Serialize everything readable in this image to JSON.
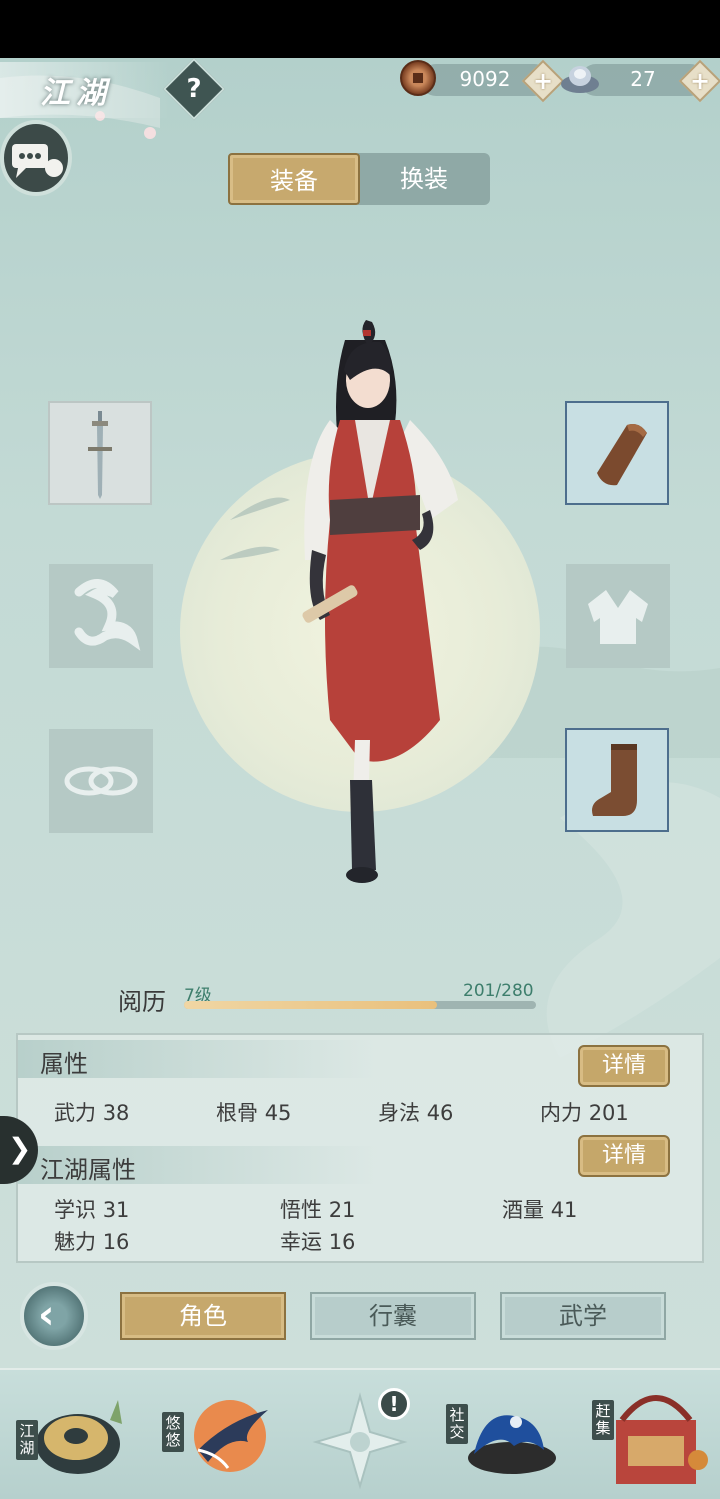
{
  "header": {
    "title": "江湖",
    "help_label": "?",
    "copper_value": "9092",
    "silver_value": "27",
    "plus_label": "+"
  },
  "tabs": {
    "equip": "装备",
    "outfit": "换装"
  },
  "slots": {
    "weapon": "sword-icon",
    "accessory": "cloud-icon",
    "ring": "ring-icon",
    "bracer": "bracer-icon",
    "armor": "robe-icon",
    "boots": "boot-icon"
  },
  "experience": {
    "label": "阅历",
    "level": "7级",
    "count": "201/280",
    "progress": 0.72
  },
  "attributes": {
    "title": "属性",
    "detail_label": "详情",
    "items": [
      {
        "name": "武力",
        "value": "38"
      },
      {
        "name": "根骨",
        "value": "45"
      },
      {
        "name": "身法",
        "value": "46"
      },
      {
        "name": "内力",
        "value": "201"
      }
    ]
  },
  "jianghu_attributes": {
    "title": "江湖属性",
    "detail_label": "详情",
    "items": [
      {
        "name": "学识",
        "value": "31"
      },
      {
        "name": "悟性",
        "value": "21"
      },
      {
        "name": "酒量",
        "value": "41"
      },
      {
        "name": "魅力",
        "value": "16"
      },
      {
        "name": "幸运",
        "value": "16"
      }
    ]
  },
  "nav": {
    "role": "角色",
    "bag": "行囊",
    "martial": "武学"
  },
  "dock": {
    "jianghu": "江湖",
    "youyou": "悠悠",
    "social": "社交",
    "market": "赶集",
    "notice": "!"
  },
  "colors": {
    "gold_button": "#c6a86c",
    "teal_background": "#c9ddd8",
    "robe_red": "#b7413a"
  }
}
